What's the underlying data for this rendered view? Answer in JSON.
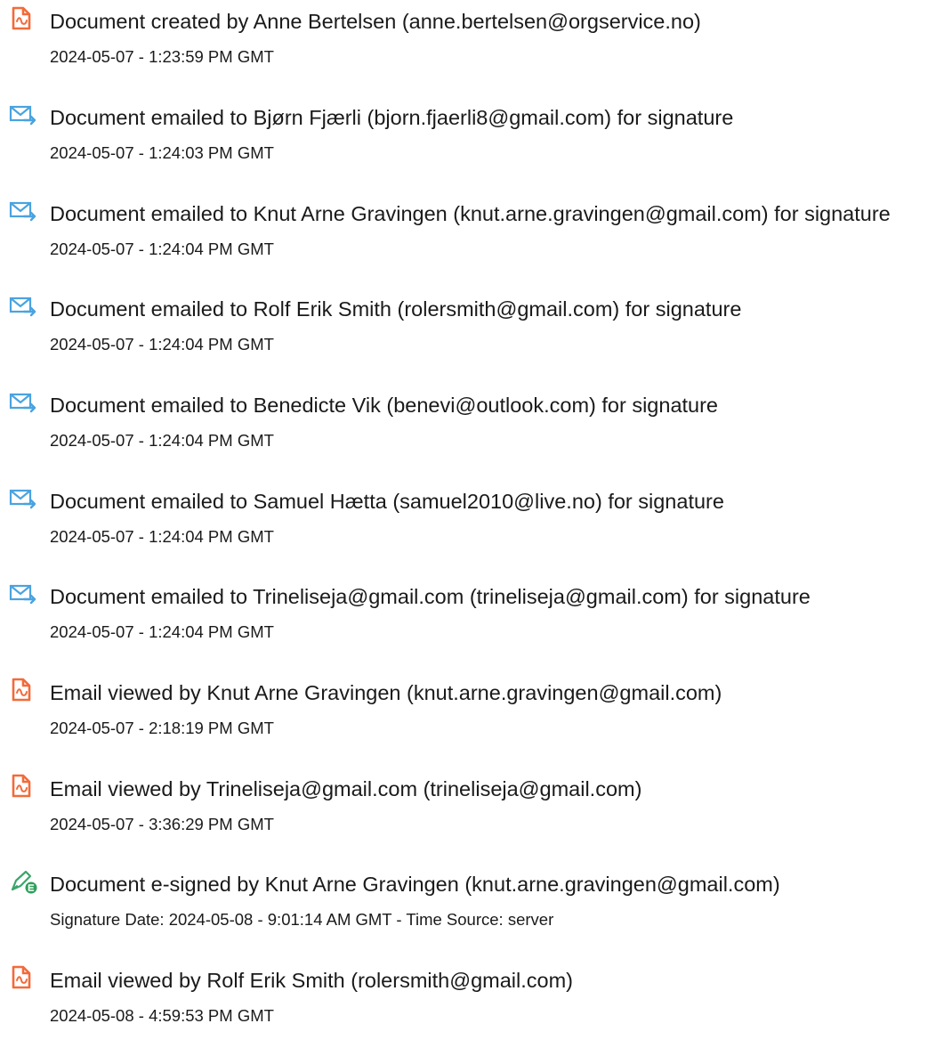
{
  "colors": {
    "doc_icon": "#f26b3a",
    "email_icon": "#4aa3df",
    "signed_pen": "#3aa66b",
    "signed_badge": "#2e9e5b"
  },
  "events": [
    {
      "icon": "document-icon",
      "title": "Document created by Anne Bertelsen (anne.bertelsen@orgservice.no)",
      "time": "2024-05-07 - 1:23:59 PM GMT"
    },
    {
      "icon": "email-sent-icon",
      "title": "Document emailed to Bjørn Fjærli (bjorn.fjaerli8@gmail.com) for signature",
      "time": "2024-05-07 - 1:24:03 PM GMT"
    },
    {
      "icon": "email-sent-icon",
      "title": "Document emailed to Knut Arne Gravingen (knut.arne.gravingen@gmail.com) for signature",
      "time": "2024-05-07 - 1:24:04 PM GMT"
    },
    {
      "icon": "email-sent-icon",
      "title": "Document emailed to Rolf Erik Smith (rolersmith@gmail.com) for signature",
      "time": "2024-05-07 - 1:24:04 PM GMT"
    },
    {
      "icon": "email-sent-icon",
      "title": "Document emailed to Benedicte Vik (benevi@outlook.com) for signature",
      "time": "2024-05-07 - 1:24:04 PM GMT"
    },
    {
      "icon": "email-sent-icon",
      "title": "Document emailed to Samuel Hætta (samuel2010@live.no) for signature",
      "time": "2024-05-07 - 1:24:04 PM GMT"
    },
    {
      "icon": "email-sent-icon",
      "title": "Document emailed to Trineliseja@gmail.com (trineliseja@gmail.com) for signature",
      "time": "2024-05-07 - 1:24:04 PM GMT"
    },
    {
      "icon": "document-icon",
      "title": "Email viewed by Knut Arne Gravingen (knut.arne.gravingen@gmail.com)",
      "time": "2024-05-07 - 2:18:19 PM GMT"
    },
    {
      "icon": "document-icon",
      "title": "Email viewed by Trineliseja@gmail.com (trineliseja@gmail.com)",
      "time": "2024-05-07 - 3:36:29 PM GMT"
    },
    {
      "icon": "e-sign-pen-icon",
      "title": "Document e-signed by Knut Arne Gravingen (knut.arne.gravingen@gmail.com)",
      "time": "Signature Date: 2024-05-08 - 9:01:14 AM GMT - Time Source: server"
    },
    {
      "icon": "document-icon",
      "title": "Email viewed by Rolf Erik Smith (rolersmith@gmail.com)",
      "time": "2024-05-08 - 4:59:53 PM GMT"
    }
  ]
}
